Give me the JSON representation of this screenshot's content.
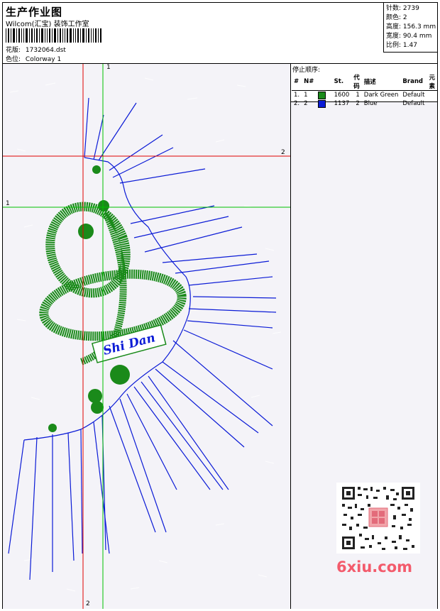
{
  "header": {
    "title": "生产作业图",
    "company": "Wilcom(汇宝) 装饰工作室",
    "design_label": "花版:",
    "design_value": "1732064.dst",
    "colorway_label": "色位:",
    "colorway_value": "Colorway 1"
  },
  "stats": [
    {
      "label": "针数:",
      "value": "2739"
    },
    {
      "label": "颜色:",
      "value": "2"
    },
    {
      "label": "高度:",
      "value": "156.3 mm"
    },
    {
      "label": "宽度:",
      "value": "90.4 mm"
    },
    {
      "label": "比例:",
      "value": "1.47"
    }
  ],
  "sequence": {
    "title": "停止顺序:",
    "columns": [
      "#",
      "N#",
      "St.",
      "代码",
      "描述",
      "Brand",
      "元素"
    ],
    "rows": [
      {
        "num": "1.",
        "n": "1",
        "color": "#1a8a1a",
        "st": "1600",
        "code": "1",
        "desc": "Dark Green",
        "brand": "Default",
        "element": ""
      },
      {
        "num": "2.",
        "n": "2",
        "color": "#0b1bd6",
        "st": "1137",
        "code": "2",
        "desc": "Blue",
        "brand": "Default",
        "element": ""
      }
    ]
  },
  "guides": {
    "vertical_red_label": "2",
    "vertical_green_label": "1",
    "horizontal_red_label": "2",
    "horizontal_green_label": "1"
  },
  "embroidery_text": "Shi Dan",
  "watermark": "6xiu.com",
  "colors": {
    "green": "#1a8a1a",
    "blue": "#0b1bd6",
    "guide_red": "#e00000",
    "guide_green": "#00c000"
  }
}
